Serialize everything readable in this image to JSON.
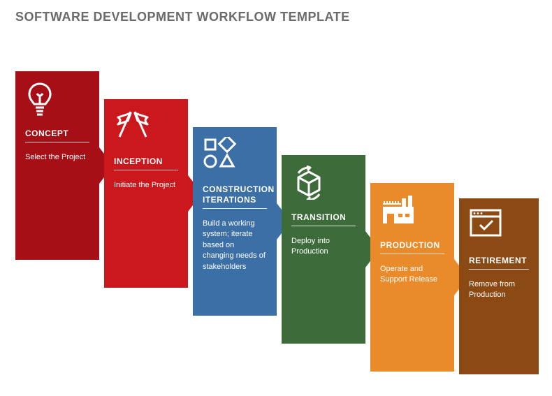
{
  "title": "SOFTWARE DEVELOPMENT WORKFLOW TEMPLATE",
  "stages": [
    {
      "label": "CONCEPT",
      "desc": "Select the Project",
      "color": "#a50f15",
      "icon": "lightbulb"
    },
    {
      "label": "INCEPTION",
      "desc": "Initiate the Project",
      "color": "#cb181d",
      "icon": "flags"
    },
    {
      "label": "CONSTRUCTION ITERATIONS",
      "desc": "Build a working system; iterate based on changing needs of stakeholders",
      "color": "#3b6fa6",
      "icon": "shapes"
    },
    {
      "label": "TRANSITION",
      "desc": "Deploy into Production",
      "color": "#3d6b39",
      "icon": "box"
    },
    {
      "label": "PRODUCTION",
      "desc": "Operate and Support Release",
      "color": "#e98b2a",
      "icon": "factory"
    },
    {
      "label": "RETIREMENT",
      "desc": "Remove from Production",
      "color": "#8b4a14",
      "icon": "window-check"
    }
  ]
}
